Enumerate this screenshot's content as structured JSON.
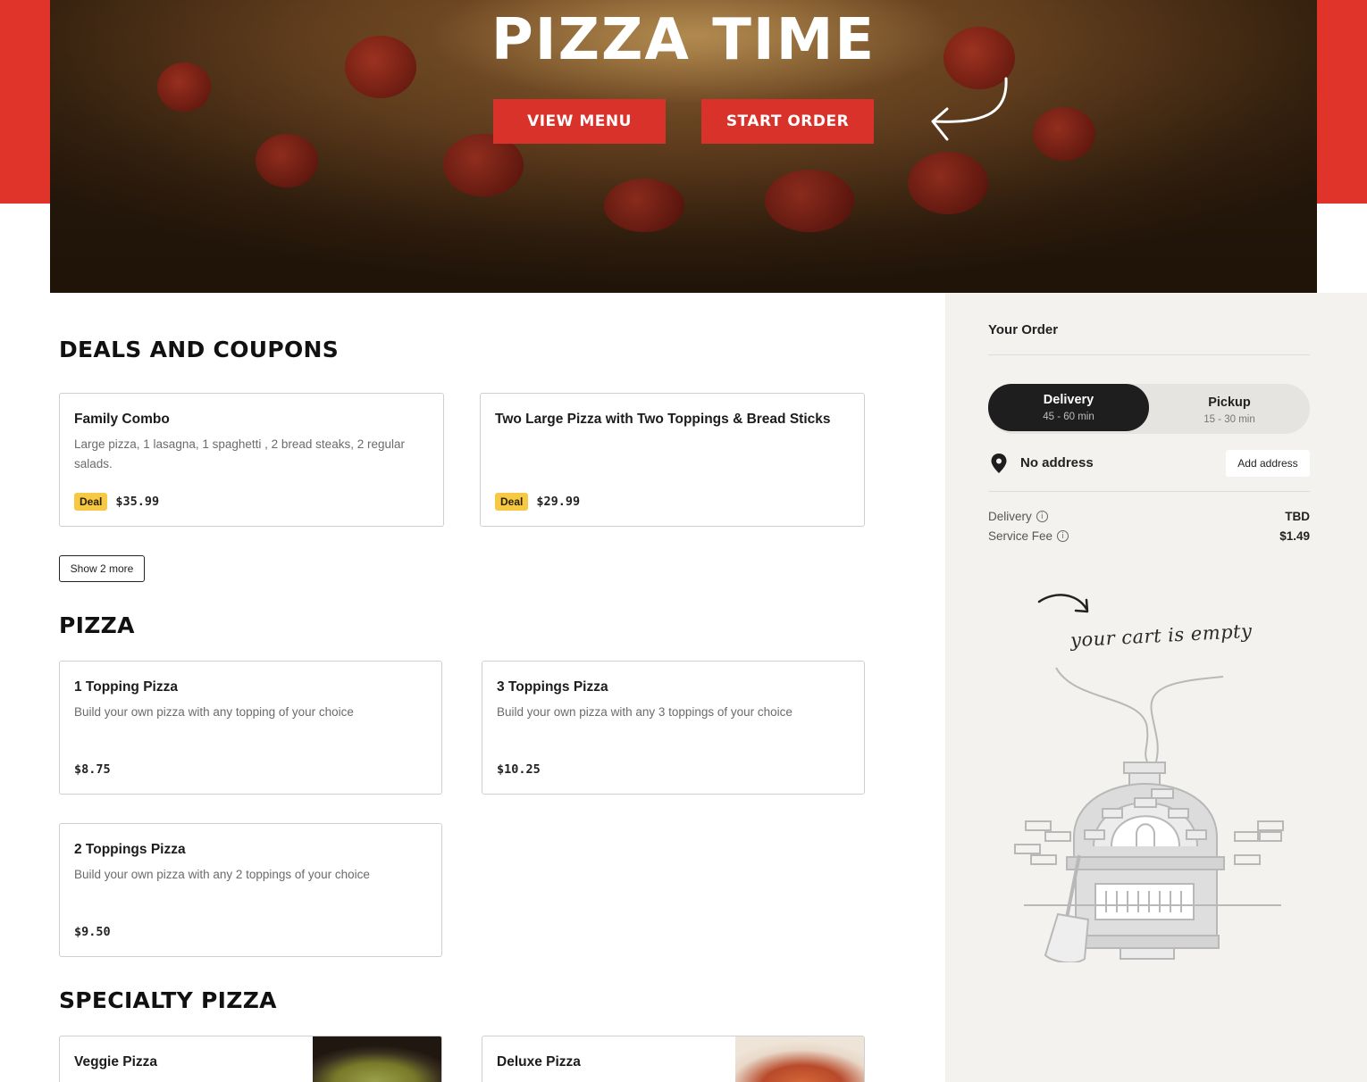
{
  "hero": {
    "title": "PIZZA TIME",
    "view_menu_label": "VIEW MENU",
    "start_order_label": "START ORDER"
  },
  "deals": {
    "title": "DEALS AND COUPONS",
    "items": [
      {
        "name": "Family Combo",
        "description": "Large pizza, 1 lasagna, 1 spaghetti , 2 bread steaks, 2 regular salads.",
        "badge": "Deal",
        "price": "$35.99"
      },
      {
        "name": "Two Large Pizza with Two Toppings & Bread Sticks",
        "description": "",
        "badge": "Deal",
        "price": "$29.99"
      }
    ],
    "show_more_label": "Show 2 more"
  },
  "pizza": {
    "title": "PIZZA",
    "items": [
      {
        "name": "1 Topping Pizza",
        "description": "Build your own pizza with any topping of your choice",
        "price": "$8.75"
      },
      {
        "name": "3 Toppings Pizza",
        "description": "Build your own pizza with any 3 toppings of your choice",
        "price": "$10.25"
      },
      {
        "name": "2 Toppings Pizza",
        "description": "Build your own pizza with any 2 toppings of your choice",
        "price": "$9.50"
      }
    ]
  },
  "specialty": {
    "title": "SPECIALTY PIZZA",
    "items": [
      {
        "name": "Veggie Pizza"
      },
      {
        "name": "Deluxe Pizza"
      }
    ]
  },
  "order": {
    "title": "Your Order",
    "delivery": {
      "label": "Delivery",
      "time": "45 - 60 min",
      "selected": true
    },
    "pickup": {
      "label": "Pickup",
      "time": "15 - 30 min",
      "selected": false
    },
    "address_text": "No address",
    "add_address_label": "Add address",
    "fees": [
      {
        "label": "Delivery",
        "value": "TBD"
      },
      {
        "label": "Service Fee",
        "value": "$1.49"
      }
    ],
    "empty_message": "your cart is empty"
  },
  "colors": {
    "brand_red": "#e0342b",
    "deal_badge": "#f6c843",
    "toggle_active": "#1e1e1e",
    "sidebar_bg": "#f3f2ef"
  },
  "icons": {
    "hero_arrow": "curved-arrow-icon",
    "pin": "location-pin-icon",
    "info": "info-icon",
    "cart_empty_arrow": "curved-arrow-icon",
    "oven": "pizza-oven-illustration"
  }
}
